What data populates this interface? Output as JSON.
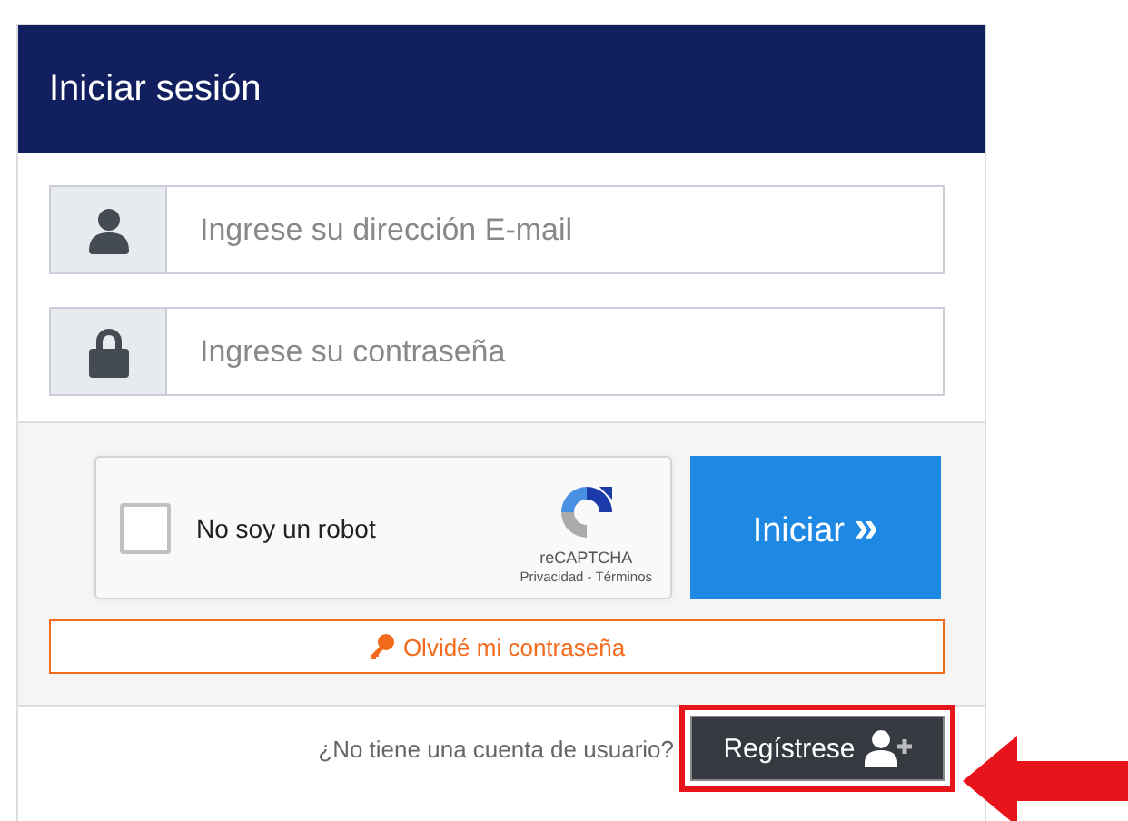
{
  "header": {
    "title": "Iniciar sesión"
  },
  "fields": [
    {
      "kind": "user",
      "placeholder": "Ingrese su dirección E-mail"
    },
    {
      "kind": "lock",
      "placeholder": "Ingrese su contraseña"
    }
  ],
  "captcha": {
    "checked": false,
    "label": "No soy un robot",
    "brand": "reCAPTCHA",
    "links": "Privacidad - Términos"
  },
  "submit": {
    "label": "Iniciar",
    "icon": "»"
  },
  "forgot": {
    "label": "Olvidé mi contraseña"
  },
  "footer": {
    "question": "¿No tiene una cuenta de usuario?",
    "register": "Regístrese",
    "highlighted": true
  }
}
